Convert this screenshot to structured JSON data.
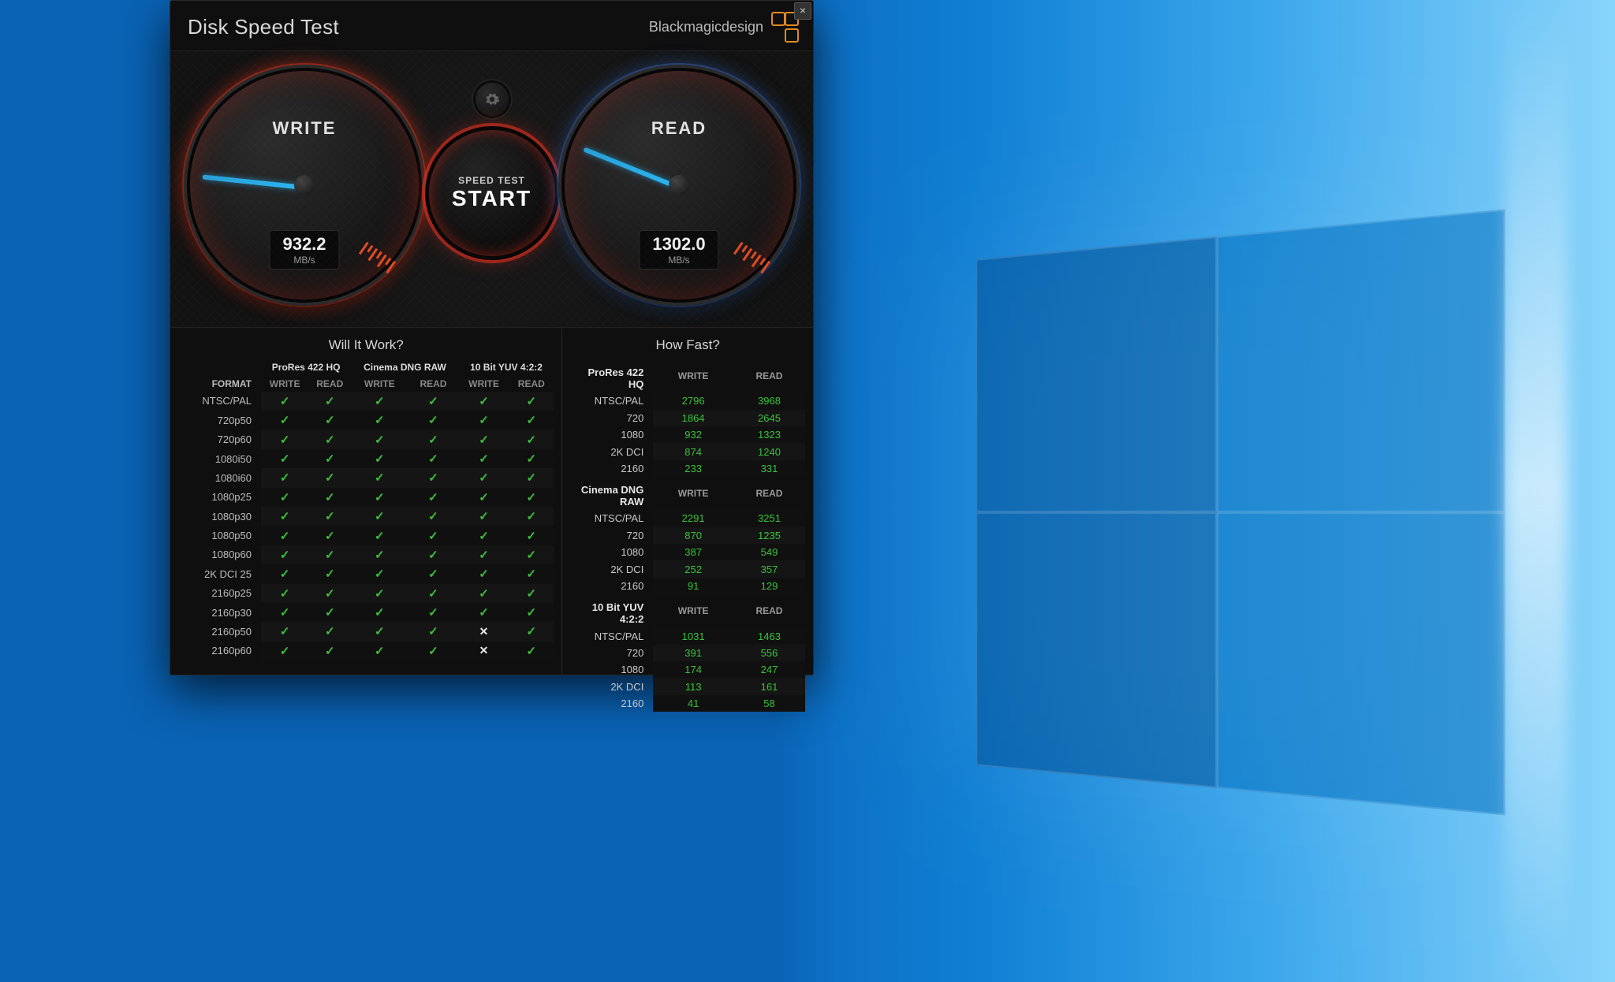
{
  "app": {
    "title": "Disk Speed Test",
    "brand": "Blackmagicdesign"
  },
  "start": {
    "line1": "SPEED TEST",
    "line2": "START"
  },
  "gauges": {
    "write": {
      "label": "WRITE",
      "value": "932.2",
      "unit": "MB/s",
      "angleDeg": 186
    },
    "read": {
      "label": "READ",
      "value": "1302.0",
      "unit": "MB/s",
      "angleDeg": 202
    }
  },
  "willItWork": {
    "title": "Will It Work?",
    "formatHeader": "FORMAT",
    "subcols": [
      "WRITE",
      "READ"
    ],
    "codecs": [
      "ProRes 422 HQ",
      "Cinema DNG RAW",
      "10 Bit YUV 4:2:2"
    ],
    "rows": [
      {
        "label": "NTSC/PAL",
        "cells": [
          true,
          true,
          true,
          true,
          true,
          true
        ]
      },
      {
        "label": "720p50",
        "cells": [
          true,
          true,
          true,
          true,
          true,
          true
        ]
      },
      {
        "label": "720p60",
        "cells": [
          true,
          true,
          true,
          true,
          true,
          true
        ]
      },
      {
        "label": "1080i50",
        "cells": [
          true,
          true,
          true,
          true,
          true,
          true
        ]
      },
      {
        "label": "1080i60",
        "cells": [
          true,
          true,
          true,
          true,
          true,
          true
        ]
      },
      {
        "label": "1080p25",
        "cells": [
          true,
          true,
          true,
          true,
          true,
          true
        ]
      },
      {
        "label": "1080p30",
        "cells": [
          true,
          true,
          true,
          true,
          true,
          true
        ]
      },
      {
        "label": "1080p50",
        "cells": [
          true,
          true,
          true,
          true,
          true,
          true
        ]
      },
      {
        "label": "1080p60",
        "cells": [
          true,
          true,
          true,
          true,
          true,
          true
        ]
      },
      {
        "label": "2K DCI 25",
        "cells": [
          true,
          true,
          true,
          true,
          true,
          true
        ]
      },
      {
        "label": "2160p25",
        "cells": [
          true,
          true,
          true,
          true,
          true,
          true
        ]
      },
      {
        "label": "2160p30",
        "cells": [
          true,
          true,
          true,
          true,
          true,
          true
        ]
      },
      {
        "label": "2160p50",
        "cells": [
          true,
          true,
          true,
          true,
          false,
          true
        ]
      },
      {
        "label": "2160p60",
        "cells": [
          true,
          true,
          true,
          true,
          false,
          true
        ]
      }
    ]
  },
  "howFast": {
    "title": "How Fast?",
    "cols": [
      "WRITE",
      "READ"
    ],
    "groups": [
      {
        "name": "ProRes 422 HQ",
        "rows": [
          {
            "label": "NTSC/PAL",
            "write": "2796",
            "read": "3968"
          },
          {
            "label": "720",
            "write": "1864",
            "read": "2645"
          },
          {
            "label": "1080",
            "write": "932",
            "read": "1323"
          },
          {
            "label": "2K DCI",
            "write": "874",
            "read": "1240"
          },
          {
            "label": "2160",
            "write": "233",
            "read": "331"
          }
        ]
      },
      {
        "name": "Cinema DNG RAW",
        "rows": [
          {
            "label": "NTSC/PAL",
            "write": "2291",
            "read": "3251"
          },
          {
            "label": "720",
            "write": "870",
            "read": "1235"
          },
          {
            "label": "1080",
            "write": "387",
            "read": "549"
          },
          {
            "label": "2K DCI",
            "write": "252",
            "read": "357"
          },
          {
            "label": "2160",
            "write": "91",
            "read": "129"
          }
        ]
      },
      {
        "name": "10 Bit YUV 4:2:2",
        "rows": [
          {
            "label": "NTSC/PAL",
            "write": "1031",
            "read": "1463"
          },
          {
            "label": "720",
            "write": "391",
            "read": "556"
          },
          {
            "label": "1080",
            "write": "174",
            "read": "247"
          },
          {
            "label": "2K DCI",
            "write": "113",
            "read": "161"
          },
          {
            "label": "2160",
            "write": "41",
            "read": "58"
          }
        ]
      }
    ]
  }
}
